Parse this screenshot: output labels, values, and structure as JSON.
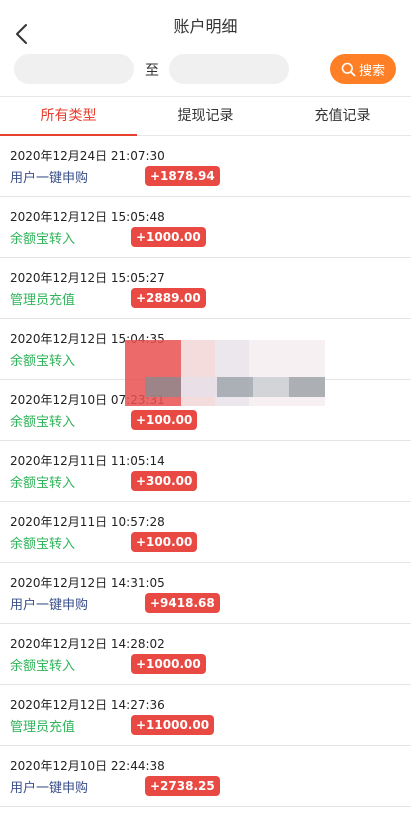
{
  "header": {
    "title": "账户明细",
    "back_icon": "chevron-left-icon"
  },
  "search": {
    "from_value": "",
    "to_label": "至",
    "to_value": "",
    "button_label": "搜索",
    "button_icon": "search-icon",
    "accent_color": "#ff7f27"
  },
  "tabs": [
    {
      "label": "所有类型",
      "active": true
    },
    {
      "label": "提现记录",
      "active": false
    },
    {
      "label": "充值记录",
      "active": false
    }
  ],
  "records": [
    {
      "time": "2020年12月24日 21:07:30",
      "type": "用户一键申购",
      "amount": "+1878.94"
    },
    {
      "time": "2020年12月12日 15:05:48",
      "type": "余额宝转入",
      "amount": "+1000.00"
    },
    {
      "time": "2020年12月12日 15:05:27",
      "type": "管理员充值",
      "amount": "+2889.00"
    },
    {
      "time": "2020年12月12日 15:04:35",
      "type": "余额宝转入",
      "amount": ""
    },
    {
      "time": "2020年12月10日 07:23:31",
      "type": "余额宝转入",
      "amount": "+100.00"
    },
    {
      "time": "2020年12月11日 11:05:14",
      "type": "余额宝转入",
      "amount": "+300.00"
    },
    {
      "time": "2020年12月11日 10:57:28",
      "type": "余额宝转入",
      "amount": "+100.00"
    },
    {
      "time": "2020年12月12日 14:31:05",
      "type": "用户一键申购",
      "amount": "+9418.68"
    },
    {
      "time": "2020年12月12日 14:28:02",
      "type": "余额宝转入",
      "amount": "+1000.00"
    },
    {
      "time": "2020年12月12日 14:27:36",
      "type": "管理员充值",
      "amount": "+11000.00"
    },
    {
      "time": "2020年12月10日 22:44:38",
      "type": "用户一键申购",
      "amount": "+2738.25"
    }
  ],
  "colors": {
    "badge": "#e84a43",
    "active_tab": "#e8402f",
    "type_purchase": "#3a4f8a",
    "type_transfer": "#2fb45a"
  }
}
